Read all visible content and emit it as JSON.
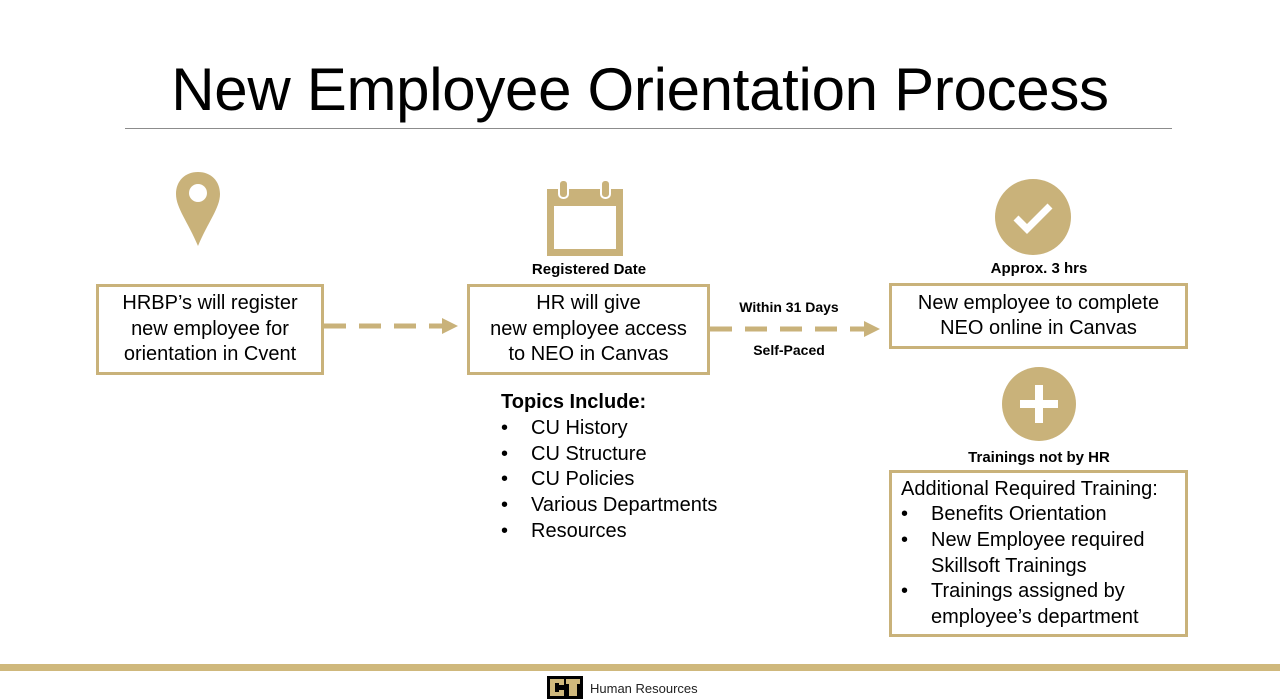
{
  "title": "New Employee Orientation Process",
  "colors": {
    "accent": "#c9b27a",
    "footer_bar": "#cfb87c",
    "rule": "#8c8c8c",
    "text": "#000000"
  },
  "steps": [
    {
      "icon": "map-pin-icon",
      "caption": "",
      "lines": [
        "HRBP’s will register",
        "new employee for",
        "orientation in Cvent"
      ]
    },
    {
      "icon": "calendar-icon",
      "caption": "Registered Date",
      "lines": [
        "HR will give",
        "new employee access",
        "to NEO in Canvas"
      ]
    },
    {
      "icon": "checkmark-circle-icon",
      "caption": "Approx. 3 hrs",
      "lines": [
        "New employee to complete",
        "NEO online in Canvas"
      ]
    }
  ],
  "connectors": [
    {
      "from": "step-1",
      "to": "step-2",
      "above": "",
      "below": ""
    },
    {
      "from": "step-2",
      "to": "step-3",
      "above": "Within 31 Days",
      "below": "Self-Paced"
    }
  ],
  "topics": {
    "heading": "Topics Include:",
    "items": [
      "CU History",
      "CU Structure",
      "CU Policies",
      "Various Departments",
      "Resources"
    ]
  },
  "additional": {
    "icon": "plus-circle-icon",
    "caption": "Trainings not by HR",
    "heading": "Additional Required Training:",
    "items": [
      "Benefits Orientation",
      "New Employee required Skillsoft Trainings",
      "Trainings assigned by employee’s department"
    ]
  },
  "footer": {
    "logo": "CU",
    "label": "Human Resources"
  }
}
